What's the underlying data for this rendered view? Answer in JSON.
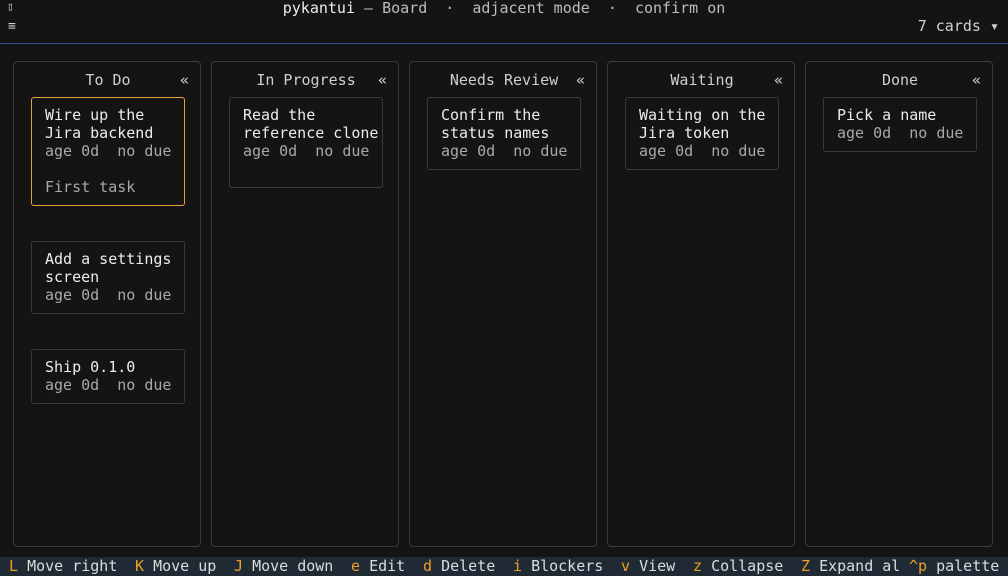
{
  "header": {
    "left_icon": "▯",
    "app_name": "pykantui",
    "sep1": " — ",
    "view": "Board",
    "sep2": "  ·  ",
    "mode": "adjacent mode",
    "sep3": "  ·  ",
    "confirm": "confirm on",
    "menu_icon": "≡",
    "cards_count": "7 cards ▾"
  },
  "colors": {
    "background": "#141414",
    "border": "#3a3a3a",
    "selected_border": "#e6a23c",
    "header_rule": "#2f4f8f",
    "footer_bg": "#202a34",
    "footer_key": "#f0a020"
  },
  "columns": [
    {
      "title": "To Do",
      "collapse": "«",
      "cards": [
        {
          "title": "Wire up the Jira backend",
          "meta": "age 0d  no due",
          "desc": "First task",
          "selected": true
        },
        {
          "title": "Add a settings screen",
          "meta": "age 0d  no due"
        },
        {
          "title": "Ship 0.1.0",
          "meta": "age 0d  no due"
        }
      ]
    },
    {
      "title": "In Progress",
      "collapse": "«",
      "cards": [
        {
          "title": "Read the reference clone",
          "meta": "age 0d  no due"
        }
      ]
    },
    {
      "title": "Needs Review",
      "collapse": "«",
      "cards": [
        {
          "title": "Confirm the status names",
          "meta": "age 0d  no due"
        }
      ]
    },
    {
      "title": "Waiting",
      "collapse": "«",
      "cards": [
        {
          "title": "Waiting on the Jira token",
          "meta": "age 0d  no due"
        }
      ]
    },
    {
      "title": "Done",
      "collapse": "«",
      "cards": [
        {
          "title": "Pick a name",
          "meta": "age 0d  no due"
        }
      ]
    }
  ],
  "footer": [
    {
      "key": "L",
      "label": "Move right"
    },
    {
      "key": "K",
      "label": "Move up"
    },
    {
      "key": "J",
      "label": "Move down"
    },
    {
      "key": "e",
      "label": "Edit"
    },
    {
      "key": "d",
      "label": "Delete"
    },
    {
      "key": "i",
      "label": "Blockers"
    },
    {
      "key": "v",
      "label": "View"
    },
    {
      "key": "z",
      "label": "Collapse"
    },
    {
      "key": "Z",
      "label": "Expand al"
    },
    {
      "key": "^p",
      "label": "palette"
    }
  ]
}
